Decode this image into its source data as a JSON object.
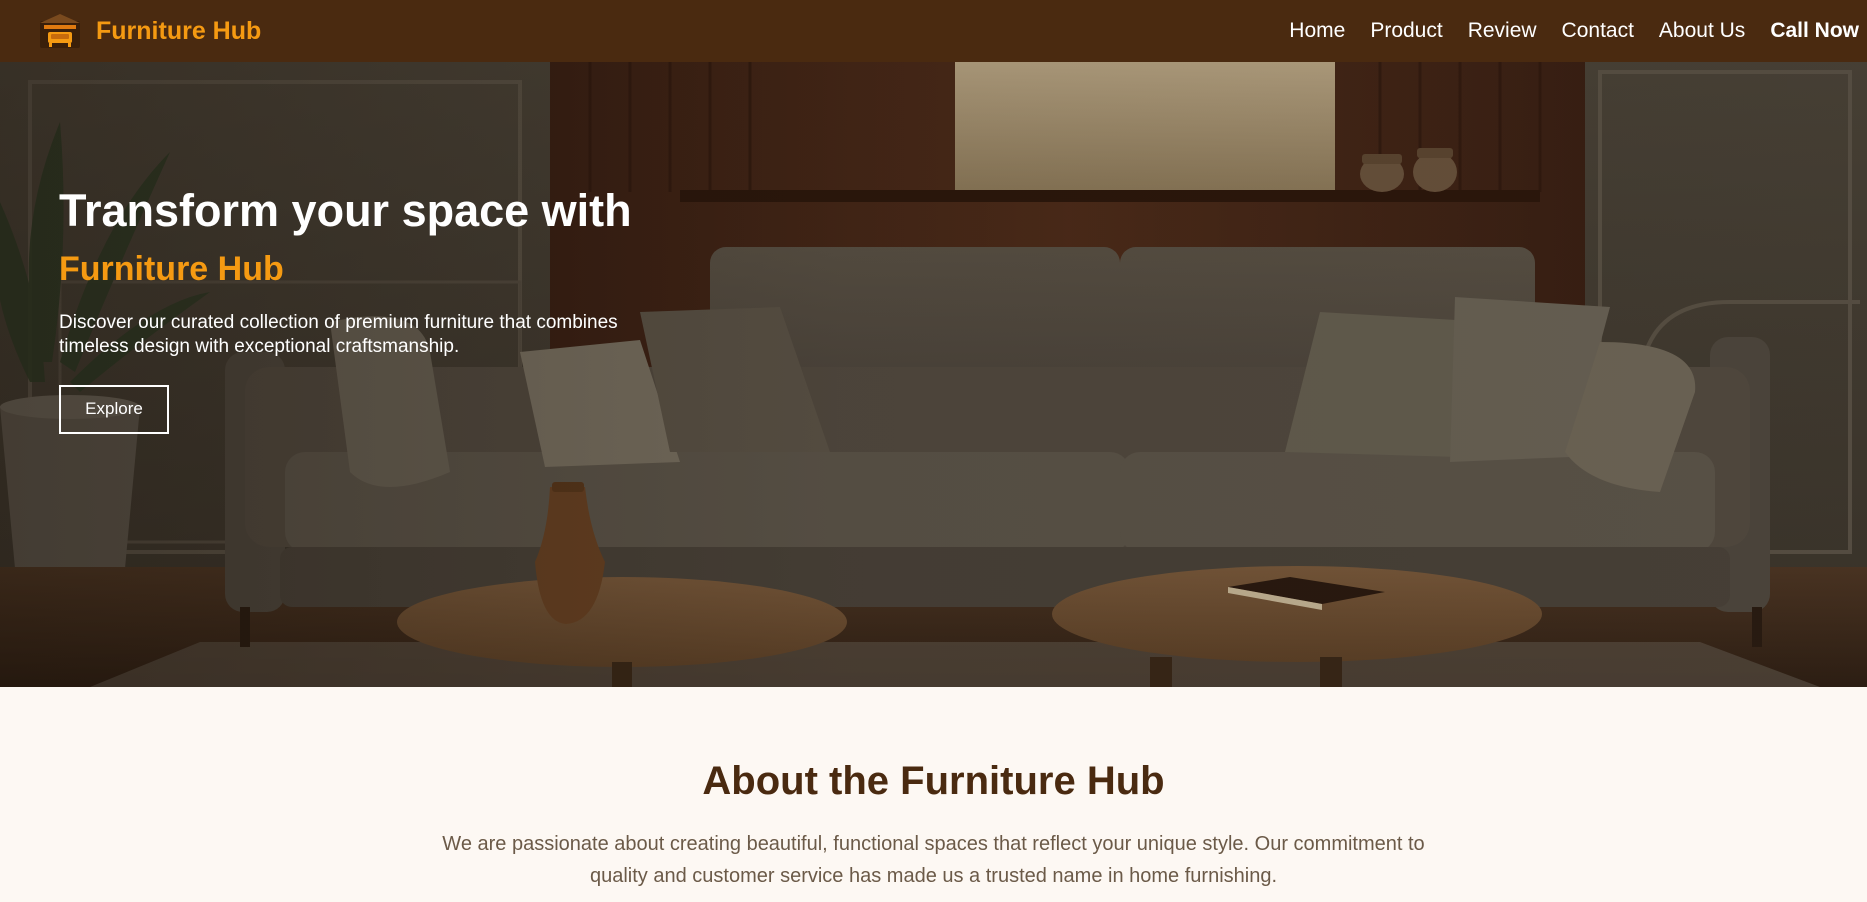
{
  "navbar": {
    "brand_name": "Furniture Hub",
    "brand_icon": "furniture-store-icon",
    "links": [
      "Home",
      "Product",
      "Review",
      "Contact",
      "About Us"
    ],
    "cta_label": "Call Now"
  },
  "hero": {
    "title": "Transform your space with",
    "accent": "Furniture Hub",
    "description": "Discover our curated collection of premium furniture that combines timeless design with exceptional craftsmanship.",
    "button_label": "Explore"
  },
  "about": {
    "title": "About the Furniture Hub",
    "text": "We are passionate about creating beautiful, functional spaces that reflect your unique style. Our commitment to quality and customer service has made us a trusted name in home furnishing."
  },
  "colors": {
    "nav_bg": "#4a2a10",
    "accent": "#f59a12",
    "about_bg": "#fdf8f3",
    "about_title": "#4a2a10",
    "about_text": "#6b5a48"
  }
}
